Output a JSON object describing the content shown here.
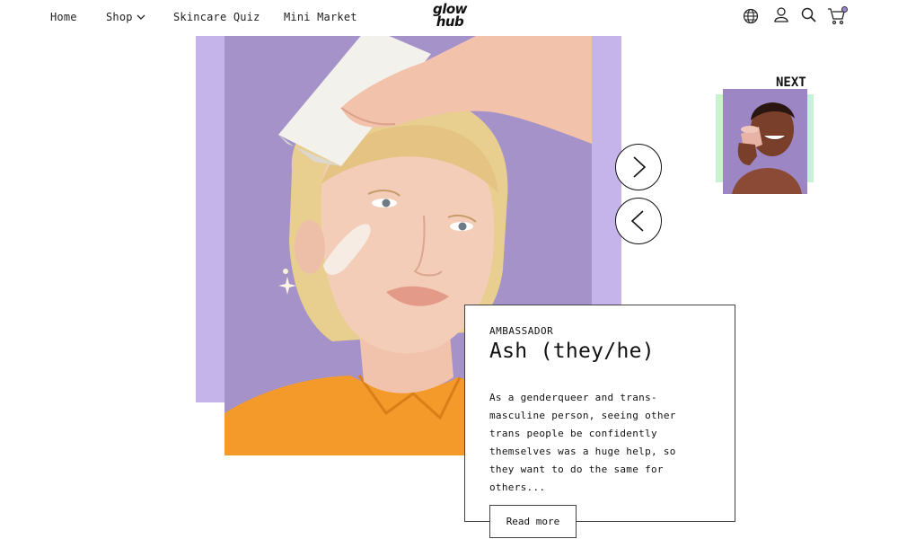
{
  "nav": {
    "links": [
      "Home",
      "Shop",
      "Skincare Quiz",
      "Mini Market"
    ],
    "logo_line1": "glow",
    "logo_line2": "hub"
  },
  "icons": {
    "globe": "globe-icon",
    "account": "user-icon",
    "search": "search-icon",
    "cart": "cart-icon",
    "shop_dropdown": "chevron-down-icon",
    "next_arrow": "chevron-right-icon",
    "prev_arrow": "chevron-left-icon"
  },
  "colors": {
    "lilac": "#c4b4ea",
    "photo_bg": "#a592c9",
    "mint": "#c9f2d2",
    "cart_dot": "#9b86d6"
  },
  "carousel": {
    "next_label": "NEXT"
  },
  "ambassador": {
    "role": "AMBASSADOR",
    "name": "Ash (they/he)",
    "quote": "As a genderqueer and trans-masculine person, seeing other trans people be confidently themselves was a huge help, so they want to do the same for others...",
    "cta": "Read more"
  }
}
